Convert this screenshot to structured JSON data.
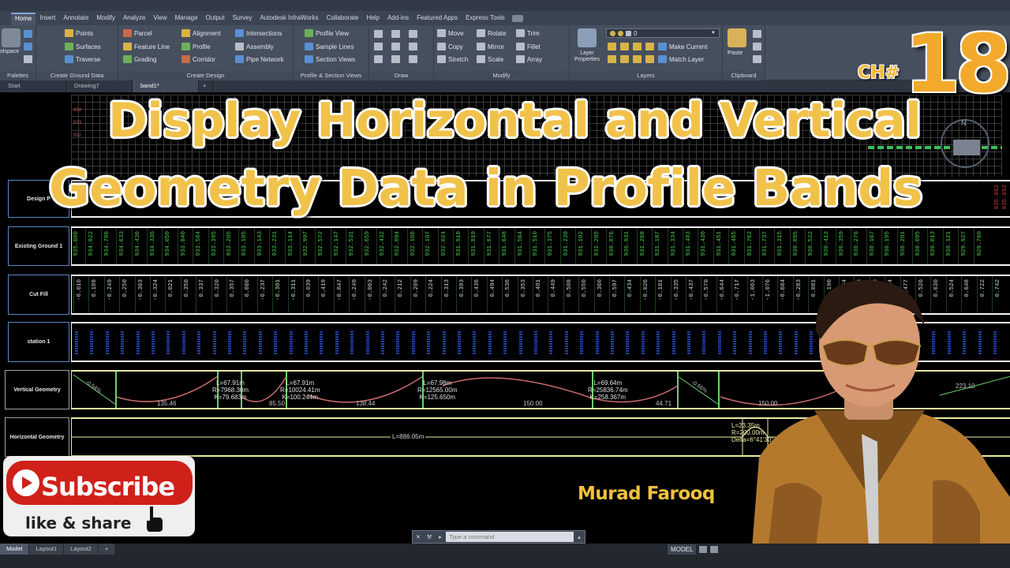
{
  "ribbon": {
    "tabs": [
      "Home",
      "Insert",
      "Annotate",
      "Modify",
      "Analyze",
      "View",
      "Manage",
      "Output",
      "Survey",
      "Autodesk InfraWorks",
      "Collaborate",
      "Help",
      "Add-ins",
      "Featured Apps",
      "Express Tools"
    ],
    "active_tab": "Home",
    "workspace_label": "olspace",
    "palettes": "Palettes",
    "create_ground_data": {
      "title": "Create Ground Data",
      "items": [
        "Points",
        "Surfaces",
        "Traverse"
      ]
    },
    "create_design": {
      "title": "Create Design",
      "items": [
        "Parcel",
        "Feature Line",
        "Grading",
        "Alignment",
        "Profile",
        "Corridor",
        "Intersections",
        "Assembly",
        "Pipe Network"
      ]
    },
    "profile_section": {
      "title": "Profile & Section Views",
      "items": [
        "Profile View",
        "Sample Lines",
        "Section Views"
      ]
    },
    "draw": {
      "title": "Draw"
    },
    "modify": {
      "title": "Modify",
      "items": [
        "Move",
        "Rotate",
        "Trim",
        "Copy",
        "Mirror",
        "Fillet",
        "Stretch",
        "Scale",
        "Array"
      ]
    },
    "layers": {
      "title": "Layers",
      "big_button": "Layer Properties",
      "current_layer": "0",
      "items": [
        "Make Current",
        "Match Layer"
      ]
    },
    "clipboard": {
      "title": "Clipboard",
      "paste": "Paste"
    }
  },
  "file_tabs": [
    "Start",
    "Drawing7",
    "band1*"
  ],
  "active_file_tab": "band1*",
  "profile_elevations": [
    "934",
    "933",
    "932"
  ],
  "bands": {
    "design_label": "Design P",
    "design_values": [
      "935.862",
      "935.652"
    ],
    "existing_label": "Existing Ground 1",
    "existing_values": [
      "935.000",
      "934.822",
      "934.786",
      "934.633",
      "934.436",
      "934.336",
      "934.050",
      "933.840",
      "933.584",
      "933.395",
      "933.205",
      "933.105",
      "933.143",
      "933.231",
      "933.114",
      "932.997",
      "932.572",
      "932.147",
      "932.531",
      "932.659",
      "932.432",
      "932.094",
      "932.106",
      "932.107",
      "932.024",
      "931.919",
      "931.819",
      "931.677",
      "931.648",
      "931.564",
      "931.510",
      "931.375",
      "931.230",
      "931.102",
      "931.205",
      "930.876",
      "930.931",
      "931.268",
      "931.187",
      "931.334",
      "931.403",
      "931.436",
      "931.451",
      "931.465",
      "931.762",
      "931.737",
      "931.315",
      "930.895",
      "930.522",
      "930.413",
      "930.359",
      "930.276",
      "930.167",
      "930.195",
      "930.201",
      "930.095",
      "930.013",
      "930.121",
      "929.927",
      "929.760"
    ],
    "cutfill_label": "Cut Fill",
    "cutfill_values": [
      "-0.010",
      "0.188",
      "-0.249",
      "0.250",
      "-0.363",
      "-0.324",
      "0.021",
      "0.350",
      "0.337",
      "0.320",
      "0.357",
      "0.080",
      "-0.237",
      "-0.301",
      "-0.311",
      "0.039",
      "0.419",
      "-0.047",
      "-0.240",
      "-0.063",
      "0.242",
      "0.212",
      "0.209",
      "0.224",
      "0.313",
      "0.393",
      "0.436",
      "0.494",
      "0.536",
      "0.353",
      "0.401",
      "0.449",
      "0.508",
      "0.550",
      "0.360",
      "0.597",
      "0.434",
      "-0.026",
      "-0.161",
      "-0.335",
      "-0.437",
      "-0.570",
      "-0.644",
      "-0.717",
      "-1.063",
      "-1.076",
      "-0.684",
      "-0.283",
      "0.081",
      "0.190",
      "0.254",
      "0.258",
      "0.338",
      "0.414",
      "0.477",
      "0.526",
      "0.630",
      "0.524",
      "0.648",
      "0.722",
      "0.742",
      "0.852"
    ],
    "station_label": "station 1",
    "vertical_label": "Vertical Geometry",
    "vertical_curves": [
      {
        "l": "L=67.91m",
        "r": "R=7968.30m",
        "k": "K=79.683m"
      },
      {
        "l": "L=67.91m",
        "r": "R=10024.41m",
        "k": "K=100.244m"
      },
      {
        "l": "L=67.98m",
        "r": "R=12565.00m",
        "k": "K=125.650m"
      },
      {
        "l": "L=69.64m",
        "r": "R=25836.74m",
        "k": "K=258.367m"
      }
    ],
    "vertical_tangents": [
      "135.46",
      "85.50",
      "138.44",
      "150.00",
      "44.71",
      "150.00",
      "223.10"
    ],
    "vertical_grades": [
      "-0.54%",
      "-0.66%"
    ],
    "horizontal_label": "Horizontal Geometry",
    "horizontal_line": "L=886.05m",
    "horizontal_curve": {
      "l": "L=23.35m",
      "r": "R=200.00m",
      "delta": "Delta=6°41'30\""
    }
  },
  "overlay": {
    "title_line1": "Display Horizontal and Vertical",
    "title_line2": "Geometry Data in Profile Bands",
    "chapter_label": "CH#",
    "chapter_number": "18",
    "subscribe": "Subscribe",
    "like_share": "like & share",
    "author": "Murad Farooq"
  },
  "command": {
    "placeholder": "Type a command"
  },
  "statusbar": {
    "layout_tabs": [
      "Model",
      "Layout1",
      "Layout2"
    ],
    "active_layout": "Model",
    "model_button": "MODEL"
  },
  "colors": {
    "title_gold": "#f1c24a",
    "band_border": "#f2f2f2",
    "existing_text": "#4fd04f",
    "design_text": "#d04040",
    "vertical_curve": "#c86a6a",
    "vertical_tangent": "#6ad06a",
    "subscribe_red": "#d0201a"
  }
}
